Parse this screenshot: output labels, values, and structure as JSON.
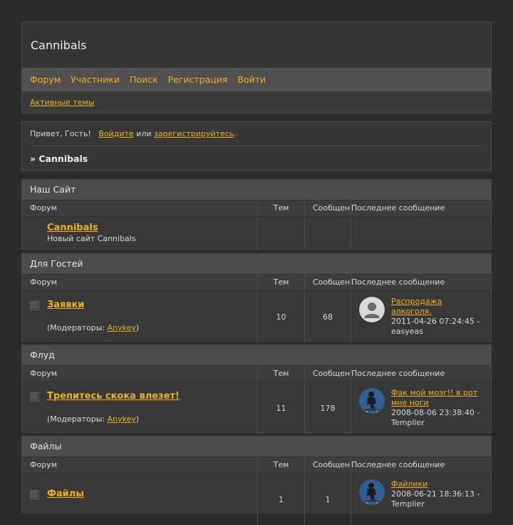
{
  "site": {
    "title": "Cannibals",
    "nav": [
      "Форум",
      "Участники",
      "Поиск",
      "Регистрация",
      "Войти"
    ],
    "active_topics": "Активные темы"
  },
  "welcome": {
    "greeting": "Привет, Гость!",
    "login": "Войдите",
    "or": "или",
    "register": "зарегистрируйтесь",
    "dot": ".",
    "breadcrumb": "» Cannibals"
  },
  "headers": {
    "forum": "Форум",
    "topics": "Тем",
    "posts": "Сообщений",
    "last": "Последнее сообщение"
  },
  "mods_label": "(Модераторы:",
  "mods_close": ")",
  "categories": [
    {
      "title": "Наш Сайт",
      "forum": {
        "name": "Cannibals",
        "desc": "Новый сайт Cannibals",
        "topics": "",
        "posts": "",
        "last": null
      }
    },
    {
      "title": "Для Гостей",
      "forum": {
        "name": "Заявки",
        "moderator": "Anykey",
        "topics": "10",
        "posts": "68",
        "last": {
          "topic": "Распродажа алкоголя.",
          "date": "2011-04-26 07:24:45 -",
          "user": "easyeas",
          "avatar": "default"
        }
      }
    },
    {
      "title": "Флуд",
      "forum": {
        "name": "Трепитесь скока влезет!",
        "moderator": "Anykey",
        "topics": "11",
        "posts": "178",
        "last": {
          "topic": "Фак мой мозг!! в рот мне ноги",
          "date": "2008-08-06 23:38:40 -",
          "user": "Templier",
          "avatar": "skater"
        }
      }
    },
    {
      "title": "Файлы",
      "forum": {
        "name": "Файлы",
        "topics": "1",
        "posts": "1",
        "last": {
          "topic": "Файлики",
          "date": "2008-06-21 18:36:13 -",
          "user": "Templier",
          "avatar": "skater"
        }
      }
    }
  ]
}
